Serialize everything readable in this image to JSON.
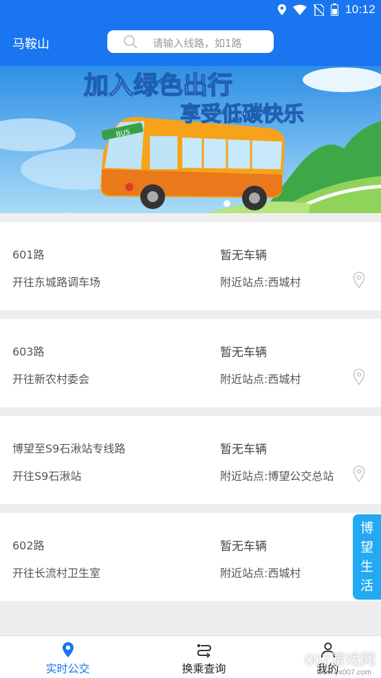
{
  "status_bar": {
    "time": "10:12",
    "icons": [
      "location-icon",
      "wifi-icon",
      "no-sim-icon",
      "battery-icon"
    ]
  },
  "header": {
    "city": "马鞍山",
    "search_placeholder": "请输入线路，如1路"
  },
  "banner": {
    "line1": "加入绿色出行",
    "line2": "享受低碳快乐",
    "bus_sign": "BUS"
  },
  "routes": [
    {
      "name": "601路",
      "direction": "开往东城路调车场",
      "status": "暂无车辆",
      "nearby": "附近站点:西城村"
    },
    {
      "name": "603路",
      "direction": "开往新农村委会",
      "status": "暂无车辆",
      "nearby": "附近站点:西城村"
    },
    {
      "name": "博望至S9石湫站专线路",
      "direction": "开往S9石湫站",
      "status": "暂无车辆",
      "nearby": "附近站点:博望公交总站"
    },
    {
      "name": "602路",
      "direction": "开往长流村卫生室",
      "status": "暂无车辆",
      "nearby": "附近站点:西城村"
    }
  ],
  "floating_tab": {
    "chars": [
      "博",
      "望",
      "生",
      "活"
    ]
  },
  "bottom_nav": {
    "items": [
      {
        "label": "实时公交",
        "icon": "map-pin-icon",
        "active": true
      },
      {
        "label": "换乘查询",
        "icon": "transfer-icon",
        "active": false
      },
      {
        "label": "我的",
        "icon": "user-icon",
        "active": false
      }
    ]
  },
  "watermark": {
    "text": "007游戏网",
    "sub": "www.yx007.com"
  },
  "colors": {
    "primary": "#1975f0",
    "float_tab": "#23a9f2"
  }
}
